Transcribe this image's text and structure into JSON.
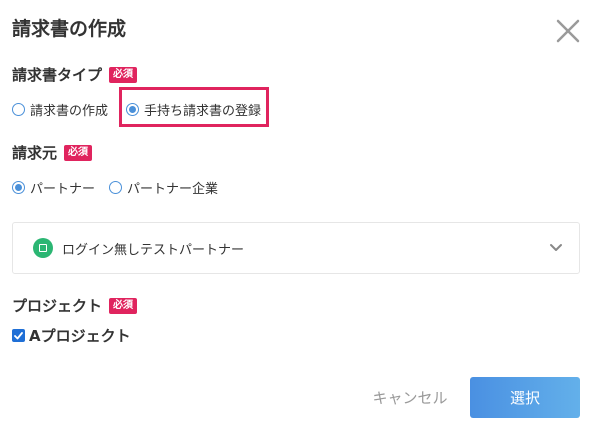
{
  "dialog": {
    "title": "請求書の作成",
    "required_badge": "必須"
  },
  "invoice_type": {
    "label": "請求書タイプ",
    "options": [
      {
        "label": "請求書の作成",
        "selected": false
      },
      {
        "label": "手持ち請求書の登録",
        "selected": true
      }
    ]
  },
  "issuer": {
    "label": "請求元",
    "options": [
      {
        "label": "パートナー",
        "selected": true
      },
      {
        "label": "パートナー企業",
        "selected": false
      }
    ],
    "selected_partner": "ログイン無しテストパートナー"
  },
  "project": {
    "label": "プロジェクト",
    "checkbox_label": "Aプロジェクト",
    "checked": true
  },
  "footer": {
    "cancel_label": "キャンセル",
    "submit_label": "選択"
  },
  "colors": {
    "accent": "#4a90d9",
    "required_badge": "#e0245e",
    "highlight_border": "#e0245e",
    "partner_icon": "#2bb673",
    "submit_button": "#4a90e2"
  },
  "icons": {
    "close": "close-icon",
    "chevron": "chevron-down-icon",
    "partner": "partner-icon"
  }
}
